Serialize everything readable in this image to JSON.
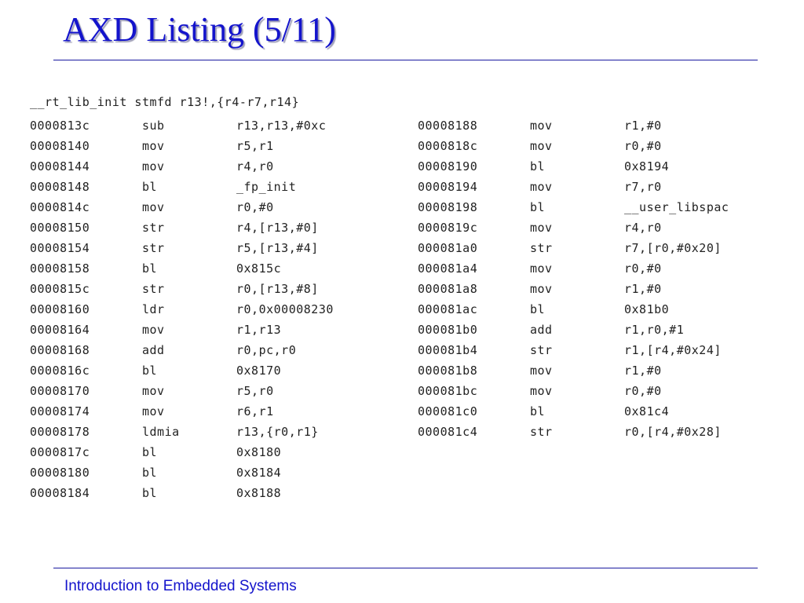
{
  "slide": {
    "title": "AXD Listing (5/11)",
    "footer": "Introduction to Embedded Systems",
    "colors": {
      "title": "#1414cc",
      "rule": "#1a1aa0",
      "footer": "#1414cc",
      "code": "#222222"
    }
  },
  "listing": {
    "header": "__rt_lib_init stmfd r13!,{r4-r7,r14}",
    "left": [
      {
        "addr": "0000813c",
        "op": "sub",
        "arg": "r13,r13,#0xc"
      },
      {
        "addr": "00008140",
        "op": "mov",
        "arg": "r5,r1"
      },
      {
        "addr": "00008144",
        "op": "mov",
        "arg": "r4,r0"
      },
      {
        "addr": "00008148",
        "op": "bl",
        "arg": "_fp_init"
      },
      {
        "addr": "0000814c",
        "op": "mov",
        "arg": "r0,#0"
      },
      {
        "addr": "00008150",
        "op": "str",
        "arg": "r4,[r13,#0]"
      },
      {
        "addr": "00008154",
        "op": "str",
        "arg": "r5,[r13,#4]"
      },
      {
        "addr": "00008158",
        "op": "bl",
        "arg": "0x815c"
      },
      {
        "addr": "0000815c",
        "op": "str",
        "arg": "r0,[r13,#8]"
      },
      {
        "addr": "00008160",
        "op": "ldr",
        "arg": "r0,0x00008230"
      },
      {
        "addr": "00008164",
        "op": "mov",
        "arg": "r1,r13"
      },
      {
        "addr": "00008168",
        "op": "add",
        "arg": "r0,pc,r0"
      },
      {
        "addr": "0000816c",
        "op": "bl",
        "arg": "0x8170"
      },
      {
        "addr": "00008170",
        "op": "mov",
        "arg": "r5,r0"
      },
      {
        "addr": "00008174",
        "op": "mov",
        "arg": "r6,r1"
      },
      {
        "addr": "00008178",
        "op": "ldmia",
        "arg": "r13,{r0,r1}"
      },
      {
        "addr": "0000817c",
        "op": "bl",
        "arg": "0x8180"
      },
      {
        "addr": "00008180",
        "op": "bl",
        "arg": "0x8184"
      },
      {
        "addr": "00008184",
        "op": "bl",
        "arg": "0x8188"
      }
    ],
    "right": [
      {
        "addr": "00008188",
        "op": "mov",
        "arg": "r1,#0"
      },
      {
        "addr": "0000818c",
        "op": "mov",
        "arg": "r0,#0"
      },
      {
        "addr": "00008190",
        "op": "bl",
        "arg": "0x8194"
      },
      {
        "addr": "00008194",
        "op": "mov",
        "arg": "r7,r0"
      },
      {
        "addr": "00008198",
        "op": "bl",
        "arg": "__user_libspac"
      },
      {
        "addr": "0000819c",
        "op": "mov",
        "arg": "r4,r0"
      },
      {
        "addr": "000081a0",
        "op": "str",
        "arg": "r7,[r0,#0x20]"
      },
      {
        "addr": "000081a4",
        "op": "mov",
        "arg": "r0,#0"
      },
      {
        "addr": "000081a8",
        "op": "mov",
        "arg": "r1,#0"
      },
      {
        "addr": "000081ac",
        "op": "bl",
        "arg": "0x81b0"
      },
      {
        "addr": "000081b0",
        "op": "add",
        "arg": "r1,r0,#1"
      },
      {
        "addr": "000081b4",
        "op": "str",
        "arg": "r1,[r4,#0x24]"
      },
      {
        "addr": "000081b8",
        "op": "mov",
        "arg": "r1,#0"
      },
      {
        "addr": "000081bc",
        "op": "mov",
        "arg": "r0,#0"
      },
      {
        "addr": "000081c0",
        "op": "bl",
        "arg": "0x81c4"
      },
      {
        "addr": "000081c4",
        "op": "str",
        "arg": "r0,[r4,#0x28]"
      }
    ]
  }
}
